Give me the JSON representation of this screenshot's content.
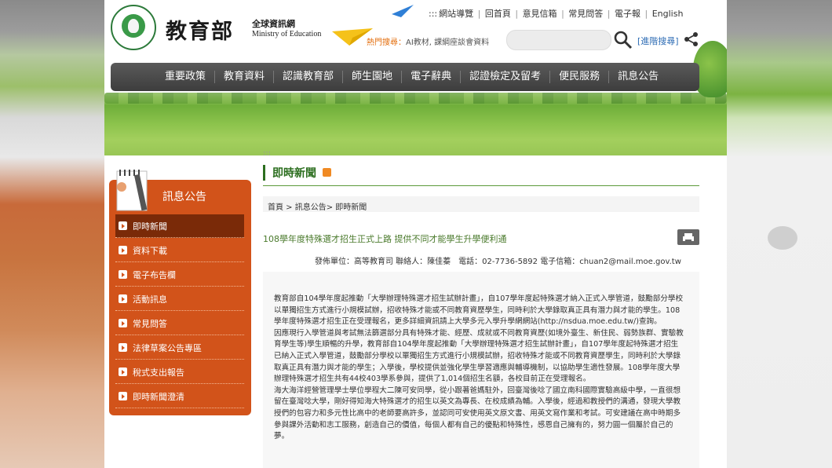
{
  "header": {
    "site_name_cn": "教育部",
    "site_sub_cn": "全球資訊網",
    "site_sub_en": "Ministry of Education",
    "top_links": [
      "網站導覽",
      "回首頁",
      "意見信箱",
      "常見問答",
      "電子報",
      "English"
    ],
    "top_links_prefix": ":::",
    "hot_label": "熱門搜尋：",
    "hot_terms": "AI教材, 課綱座談會資料",
    "search_placeholder": "",
    "advanced_search": "[進階搜尋]"
  },
  "nav": {
    "items": [
      "重要政策",
      "教育資料",
      "認識教育部",
      "師生園地",
      "電子辭典",
      "認證檢定及留考",
      "便民服務",
      "訊息公告"
    ]
  },
  "sidebar": {
    "title": "訊息公告",
    "items": [
      {
        "label": "即時新聞",
        "active": true
      },
      {
        "label": "資料下載",
        "active": false
      },
      {
        "label": "電子布告欄",
        "active": false
      },
      {
        "label": "活動訊息",
        "active": false
      },
      {
        "label": "常見問答",
        "active": false
      },
      {
        "label": "法律草案公告專區",
        "active": false
      },
      {
        "label": "稅式支出報告",
        "active": false
      },
      {
        "label": "即時新聞澄清",
        "active": false
      }
    ]
  },
  "content": {
    "dots": ":::",
    "section_title": "即時新聞",
    "breadcrumb": "首頁 > 訊息公告> 即時新聞",
    "article_title": "108學年度特殊選才招生正式上路 提供不同才能學生升學便利通",
    "meta": "發佈單位：高等教育司 聯絡人：陳佳蓁　電話：02-7736-5892 電子信箱：chuan2@mail.moe.gov.tw",
    "paragraphs": [
      "教育部自104學年度起推動「大學辦理特殊選才招生試辦計畫」，自107學年度起特殊選才納入正式入學管道，鼓勵部分學校以單獨招生方式進行小規模試辦，招收特殊才能或不同教育資歷學生，同時利於大學錄取真正具有潛力與才能的學生。108學年度特殊選才招生正在受理報名，更多詳細資訊請上大學多元入學升學網網站(http://nsdua.moe.edu.tw/)查詢。",
      "因應現行入學管道與考試無法篩選部分具有特殊才能、經歷、成就或不同教育資歷(如境外臺生、新住民、弱勢族群、實驗教育學生等)學生順暢的升學，教育部自104學年度起推動「大學辦理特殊選才招生試辦計畫」，自107學年度起特殊選才招生已納入正式入學管道，鼓勵部分學校以單獨招生方式進行小規模試辦，招收特殊才能或不同教育資歷學生，同時利於大學錄取真正具有潛力與才能的學生；入學後，學校提供並強化學生學習適應與輔導機制，以協助學生適性發展。108學年度大學辦理特殊選才招生共有44校403學系參與，提供了1,014個招生名額，各校目前正在受理報名。",
      "海大海洋經營管理學士學位學程大二陳可安同學，從小跟著爸媽駐外，回臺灣後唸了國立南科國際實驗高級中學，一直很想留在臺灣唸大學，剛好得知海大特殊選才的招生以英文為專長、在校成績為輔。入學後，經過和教授們的溝通，發現大學教授們的包容力和多元性比高中的老師要高許多，並認同可安使用英文原文書、用英文寫作業和考試。可安建議在高中時期多參與課外活動和志工服務，創造自己的價值，每個人都有自己的優點和特殊性，感恩自己擁有的，努力圓一個屬於自己的夢。"
    ]
  },
  "colors": {
    "sidebar": "#d2531a",
    "sidebar_active": "#7a2a08",
    "nav": "#4a4a4a",
    "title_green": "#2c6e1f",
    "hot_label": "#e36c0a",
    "link_blue": "#2f6db5"
  }
}
